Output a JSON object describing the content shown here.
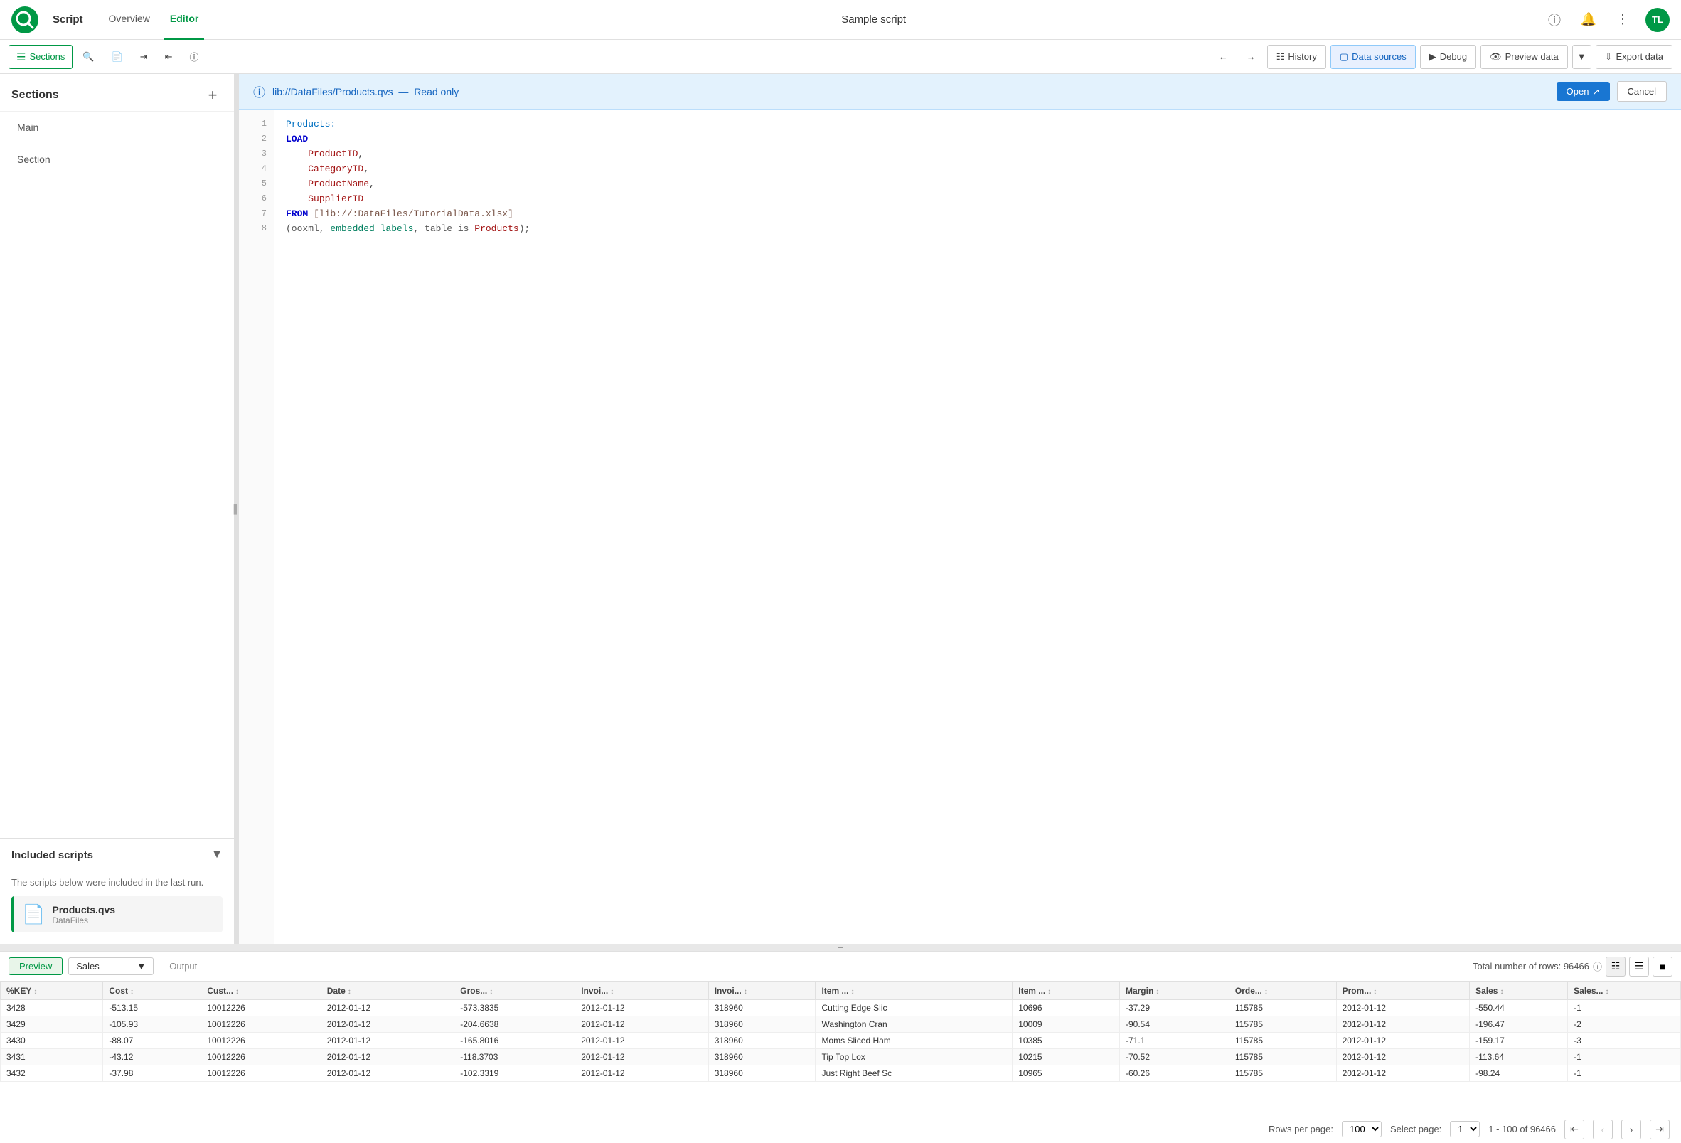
{
  "app": {
    "name": "Qlik",
    "script_label": "Script",
    "title": "Sample script",
    "user_initials": "TL"
  },
  "nav": {
    "tabs": [
      {
        "id": "overview",
        "label": "Overview",
        "active": false
      },
      {
        "id": "editor",
        "label": "Editor",
        "active": true
      }
    ]
  },
  "toolbar": {
    "sections_label": "Sections",
    "history_label": "History",
    "data_sources_label": "Data sources",
    "debug_label": "Debug",
    "preview_data_label": "Preview data",
    "export_data_label": "Export data"
  },
  "sidebar": {
    "title": "Sections",
    "add_label": "+",
    "items": [
      {
        "id": "main",
        "label": "Main"
      },
      {
        "id": "section",
        "label": "Section"
      }
    ],
    "included_scripts": {
      "title": "Included scripts",
      "description": "The scripts below were included in the last run.",
      "files": [
        {
          "name": "Products.qvs",
          "path": "DataFiles"
        }
      ]
    }
  },
  "readonly_banner": {
    "file": "lib://DataFiles/Products.qvs",
    "mode": "Read only",
    "open_label": "Open",
    "cancel_label": "Cancel"
  },
  "code": {
    "lines": [
      {
        "num": 1,
        "text": "Products:"
      },
      {
        "num": 2,
        "text": "LOAD"
      },
      {
        "num": 3,
        "text": "    ProductID,"
      },
      {
        "num": 4,
        "text": "    CategoryID,"
      },
      {
        "num": 5,
        "text": "    ProductName,"
      },
      {
        "num": 6,
        "text": "    SupplierID"
      },
      {
        "num": 7,
        "text": "FROM [lib://:DataFiles/TutorialData.xlsx]"
      },
      {
        "num": 8,
        "text": "(ooxml, embedded labels, table is Products);"
      }
    ]
  },
  "preview": {
    "preview_label": "Preview",
    "table_label": "Sales",
    "output_label": "Output",
    "total_rows_label": "Total number of rows: 96466",
    "columns": [
      "%KEY",
      "Cost",
      "Cust...",
      "Date",
      "Gros...",
      "Invoi...",
      "Invoi...",
      "Item ...",
      "Item ...",
      "Margin",
      "Orde...",
      "Prom...",
      "Sales",
      "Sales..."
    ],
    "rows": [
      [
        "3428",
        "-513.15",
        "10012226",
        "2012-01-12",
        "-573.3835",
        "2012-01-12",
        "318960",
        "Cutting Edge Slic",
        "10696",
        "-37.29",
        "115785",
        "2012-01-12",
        "-550.44",
        "-1"
      ],
      [
        "3429",
        "-105.93",
        "10012226",
        "2012-01-12",
        "-204.6638",
        "2012-01-12",
        "318960",
        "Washington Cran",
        "10009",
        "-90.54",
        "115785",
        "2012-01-12",
        "-196.47",
        "-2"
      ],
      [
        "3430",
        "-88.07",
        "10012226",
        "2012-01-12",
        "-165.8016",
        "2012-01-12",
        "318960",
        "Moms Sliced Ham",
        "10385",
        "-71.1",
        "115785",
        "2012-01-12",
        "-159.17",
        "-3"
      ],
      [
        "3431",
        "-43.12",
        "10012226",
        "2012-01-12",
        "-118.3703",
        "2012-01-12",
        "318960",
        "Tip Top Lox",
        "10215",
        "-70.52",
        "115785",
        "2012-01-12",
        "-113.64",
        "-1"
      ],
      [
        "3432",
        "-37.98",
        "10012226",
        "2012-01-12",
        "-102.3319",
        "2012-01-12",
        "318960",
        "Just Right Beef Sc",
        "10965",
        "-60.26",
        "115785",
        "2012-01-12",
        "-98.24",
        "-1"
      ]
    ]
  },
  "pagination": {
    "rows_per_page_label": "Rows per page:",
    "rows_per_page_value": "100",
    "select_page_label": "Select page:",
    "page_value": "1",
    "range_label": "1 - 100 of 96466"
  }
}
